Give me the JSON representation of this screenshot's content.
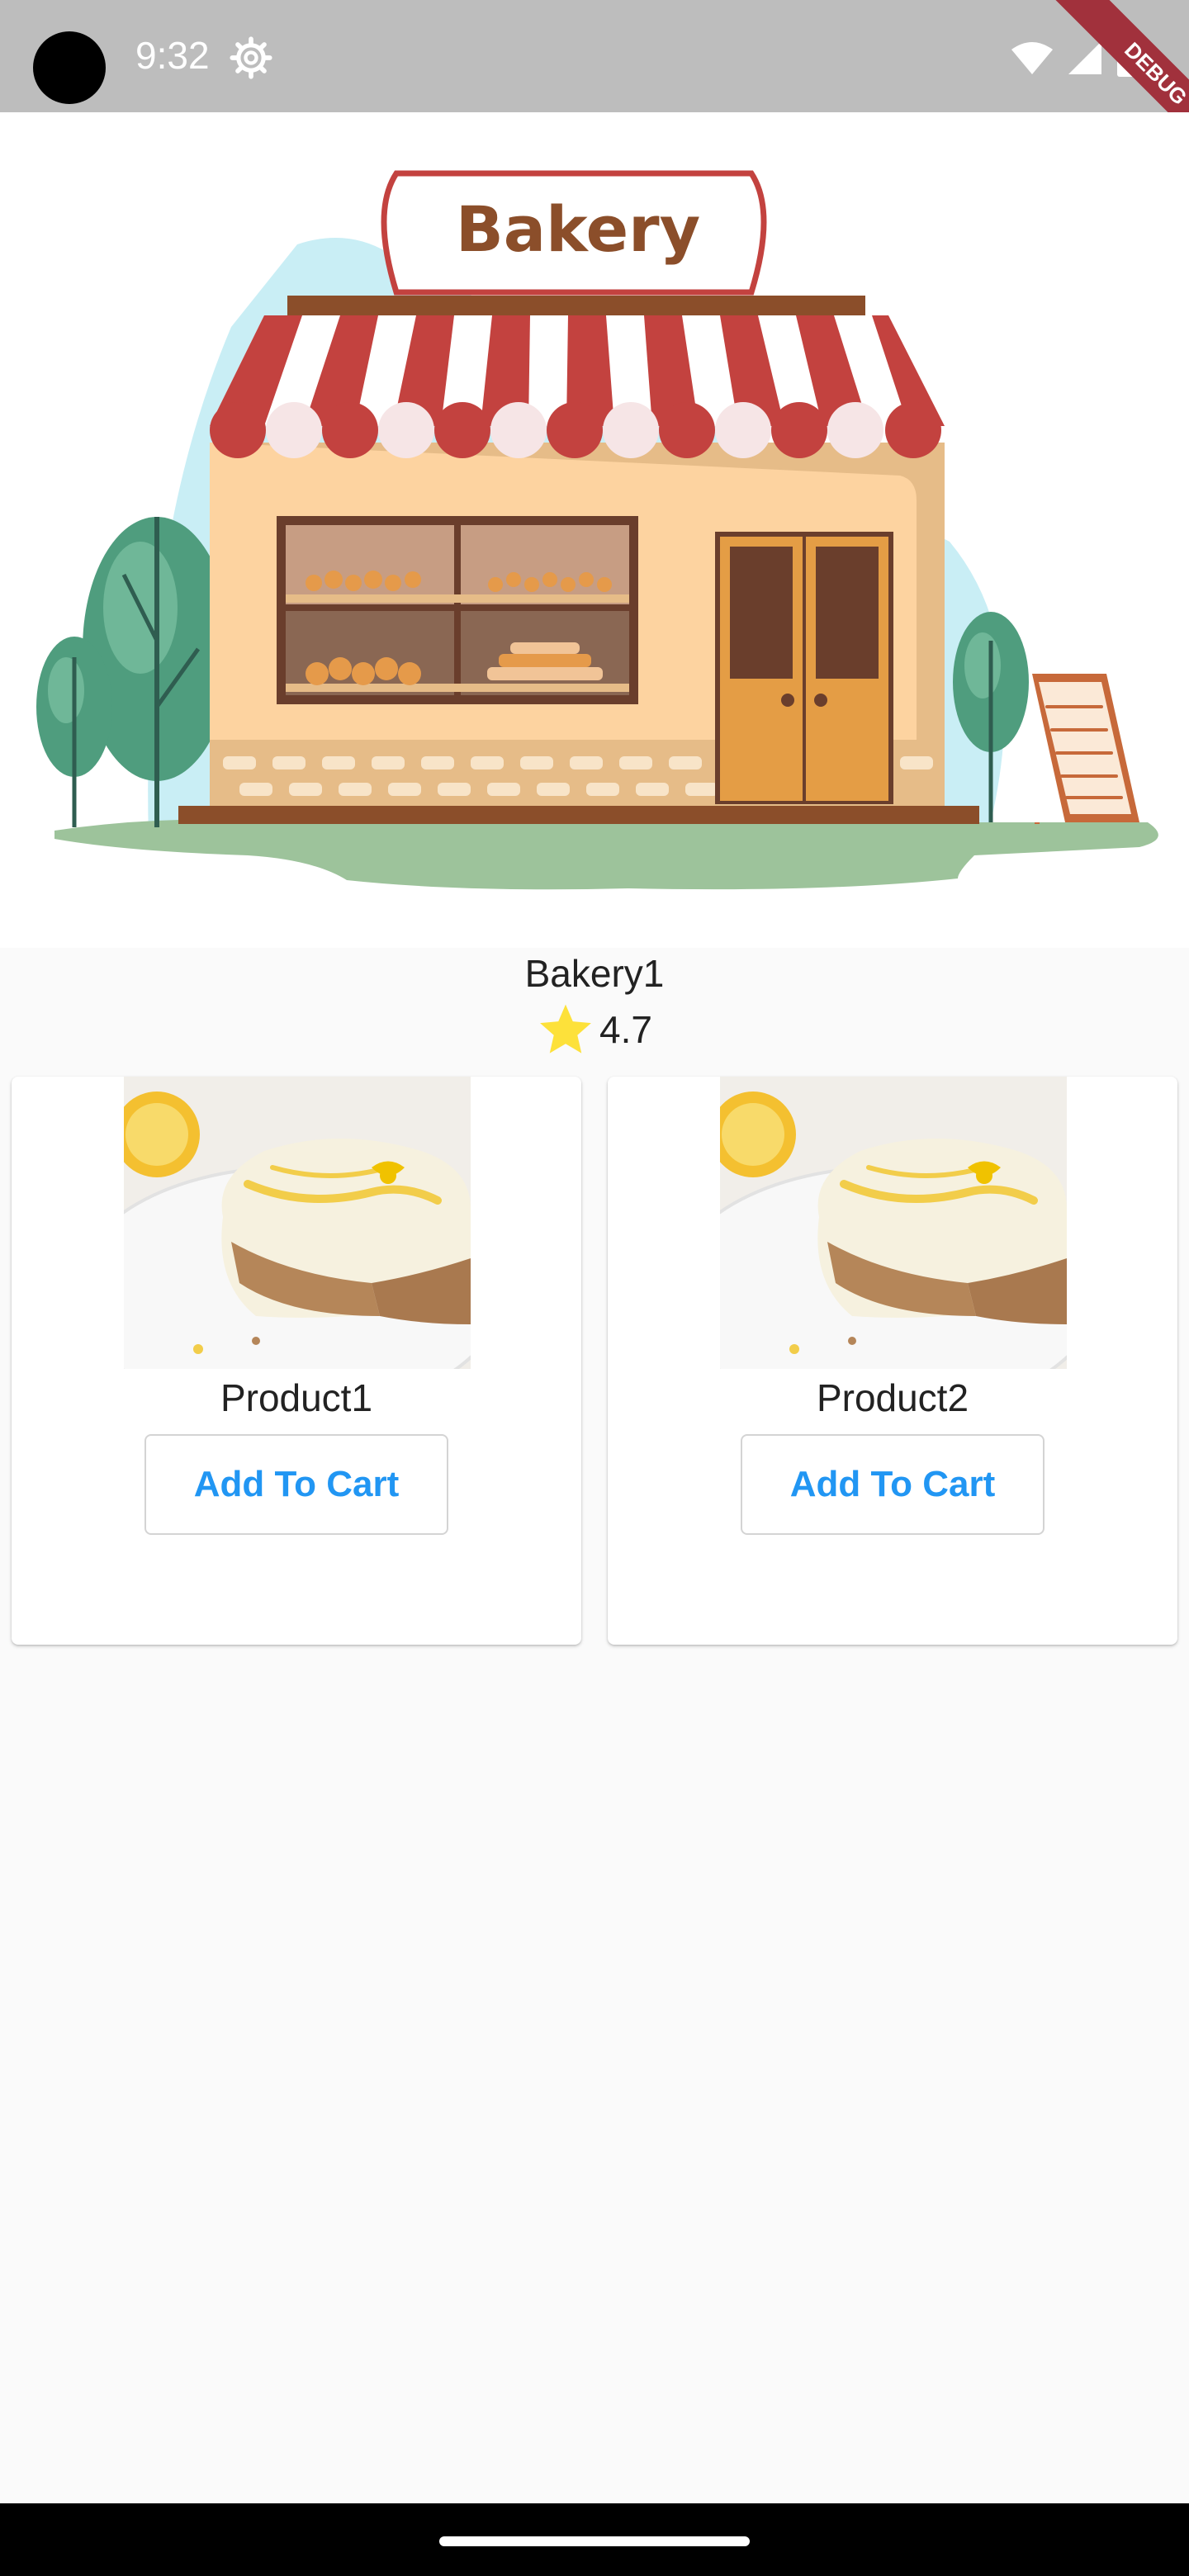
{
  "status_bar": {
    "time": "9:32",
    "icons": [
      "settings-icon",
      "wifi-icon",
      "cellular-signal-icon",
      "battery-icon"
    ],
    "debug_banner": "DEBUG"
  },
  "hero": {
    "image": "bakery-storefront-illustration",
    "sign_text": "Bakery"
  },
  "shop": {
    "name": "Bakery1",
    "rating": "4.7",
    "rating_icon": "star-icon"
  },
  "products": [
    {
      "name": "Product1",
      "image": "lemon-cheesecake-photo",
      "button_label": "Add To Cart"
    },
    {
      "name": "Product2",
      "image": "lemon-cheesecake-photo",
      "button_label": "Add To Cart"
    }
  ],
  "colors": {
    "accent": "#2196f3",
    "star": "#fde13a",
    "status_bar": "#bdbdbd",
    "awning_red": "#c3423f",
    "storefront": "#fdd3a0"
  }
}
